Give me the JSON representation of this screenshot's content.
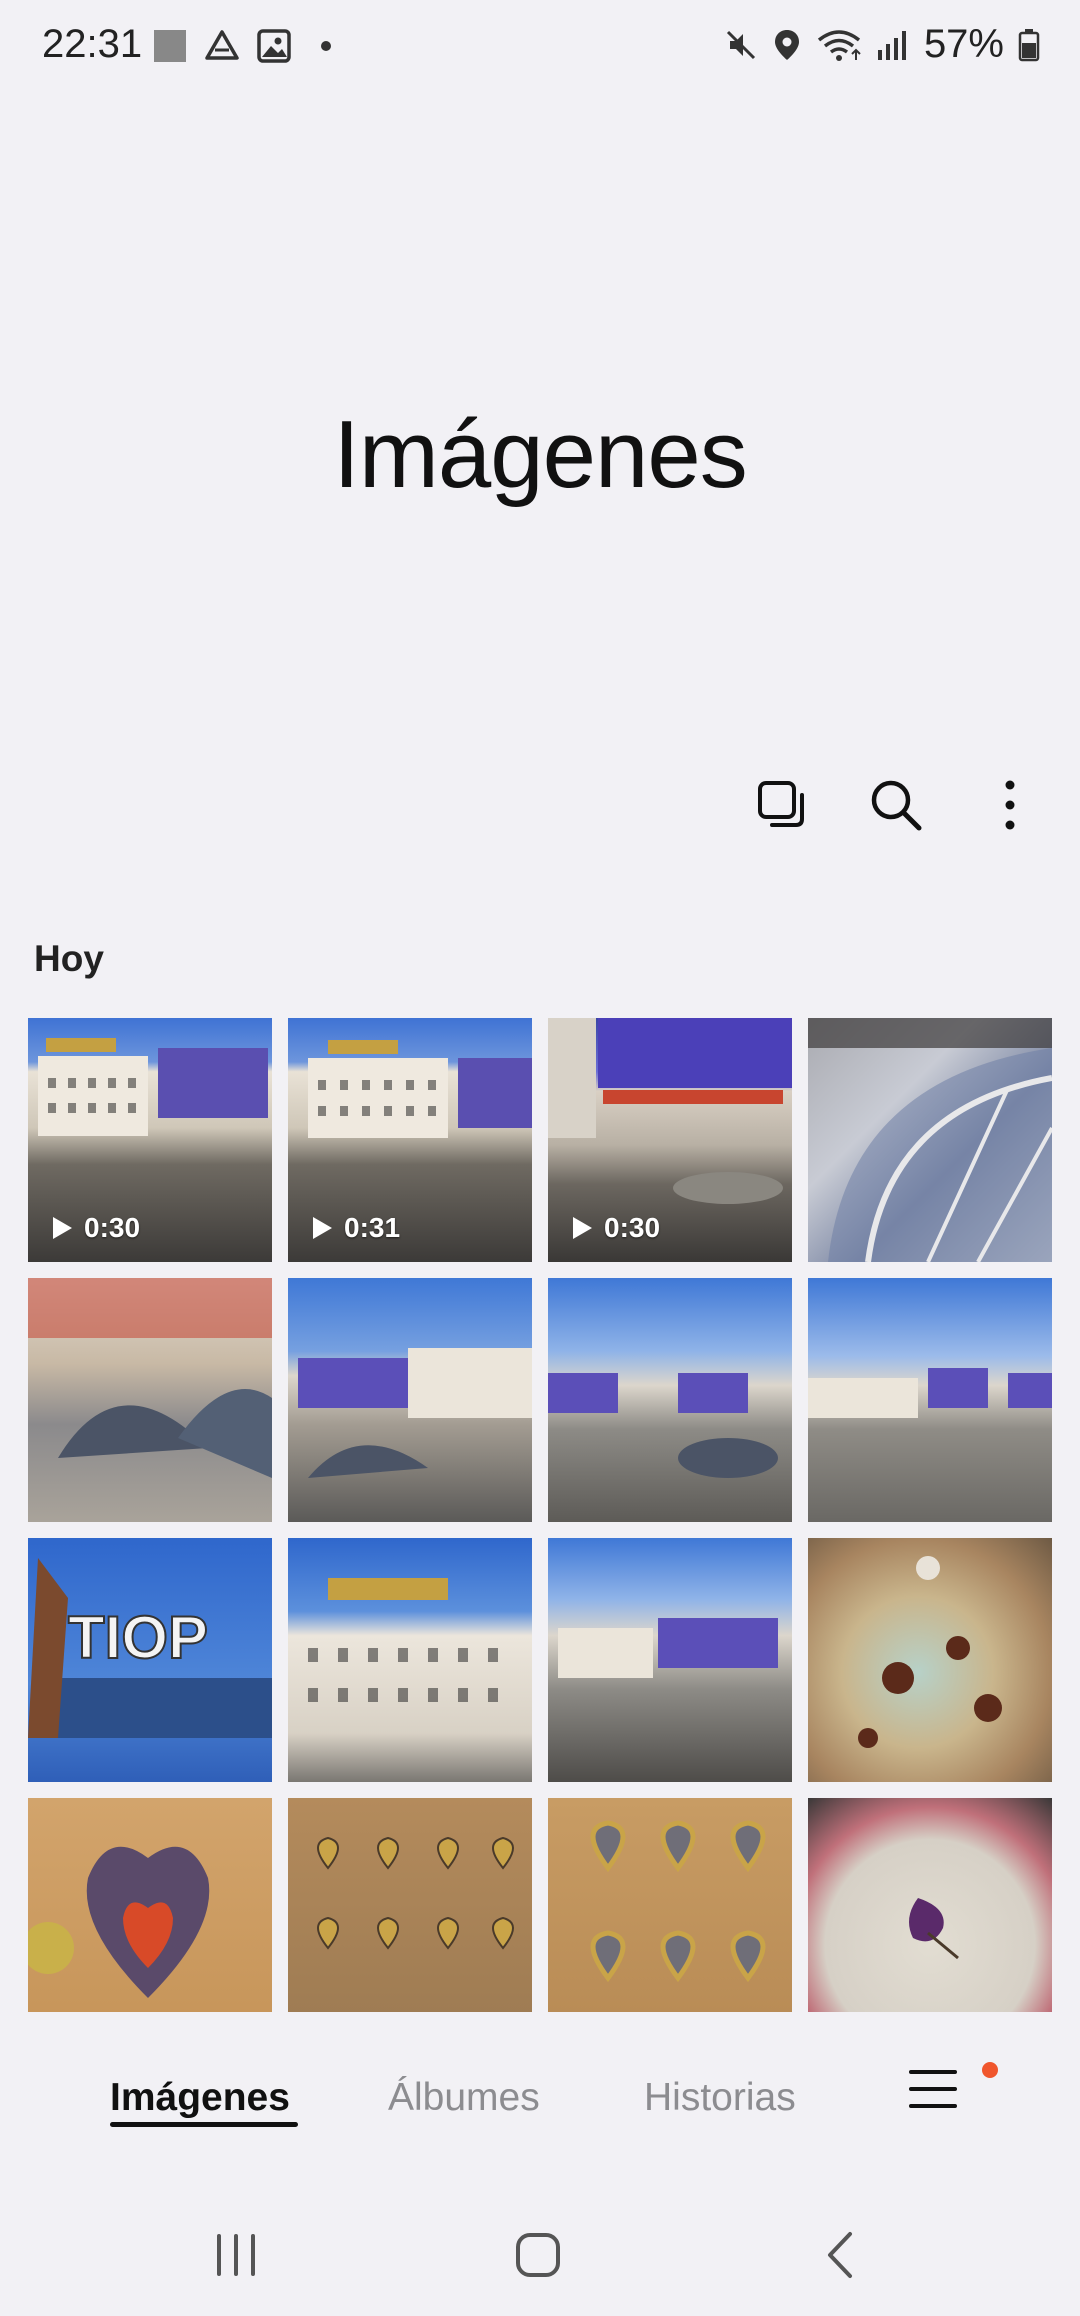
{
  "status_bar": {
    "time": "22:31",
    "battery": "57%",
    "left_icons": [
      "screenshot-icon",
      "drive-icon",
      "gallery-icon",
      "dot-icon"
    ],
    "right_icons": [
      "mute-icon",
      "location-icon",
      "wifi-icon",
      "signal-icon",
      "battery-icon"
    ]
  },
  "page_title": "Imágenes",
  "toolbar": {
    "actions": [
      "select-icon",
      "search-icon",
      "more-options-icon"
    ]
  },
  "section": {
    "heading": "Hoy"
  },
  "thumbnails": [
    {
      "type": "video",
      "duration": "0:30"
    },
    {
      "type": "video",
      "duration": "0:31"
    },
    {
      "type": "video",
      "duration": "0:30"
    },
    {
      "type": "image"
    },
    {
      "type": "image"
    },
    {
      "type": "image"
    },
    {
      "type": "image"
    },
    {
      "type": "image"
    },
    {
      "type": "image"
    },
    {
      "type": "image"
    },
    {
      "type": "image"
    },
    {
      "type": "image"
    },
    {
      "type": "image"
    },
    {
      "type": "image"
    },
    {
      "type": "image"
    },
    {
      "type": "image"
    }
  ],
  "bottom_tabs": {
    "items": [
      {
        "label": "Imágenes",
        "active": true
      },
      {
        "label": "Álbumes",
        "active": false
      },
      {
        "label": "Historias",
        "active": false
      }
    ],
    "menu_badge_color": "#f0562c"
  },
  "nav_bar": {
    "buttons": [
      "recents-icon",
      "home-icon",
      "back-icon"
    ]
  },
  "colors": {
    "background": "#f2f1f5",
    "accent_dot": "#f0562c",
    "inactive_tab": "#8c8c90"
  }
}
